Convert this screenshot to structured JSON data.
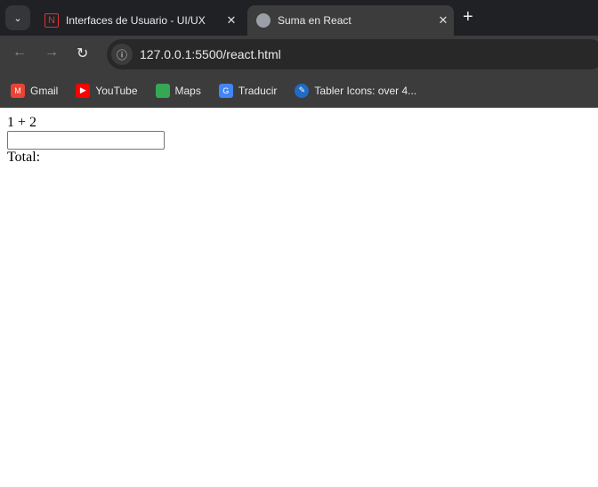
{
  "browser": {
    "tabs": [
      {
        "title": "Interfaces de Usuario - UI/UX",
        "icon": "notion-icon",
        "active": false
      },
      {
        "title": "Suma en React",
        "icon": "globe-icon",
        "active": true
      }
    ],
    "url": "127.0.0.1:5500/react.html",
    "bookmarks": [
      {
        "label": "Gmail",
        "icon": "gmail-icon",
        "color": "#ea4335"
      },
      {
        "label": "YouTube",
        "icon": "youtube-icon",
        "color": "#ff0000"
      },
      {
        "label": "Maps",
        "icon": "maps-icon",
        "color": "#34a853"
      },
      {
        "label": "Traducir",
        "icon": "translate-icon",
        "color": "#4285f4"
      },
      {
        "label": "Tabler Icons: over 4...",
        "icon": "tabler-icon",
        "color": "#206bc4"
      }
    ]
  },
  "page": {
    "expression": "1 + 2",
    "input_value": "",
    "total_label": "Total:"
  }
}
